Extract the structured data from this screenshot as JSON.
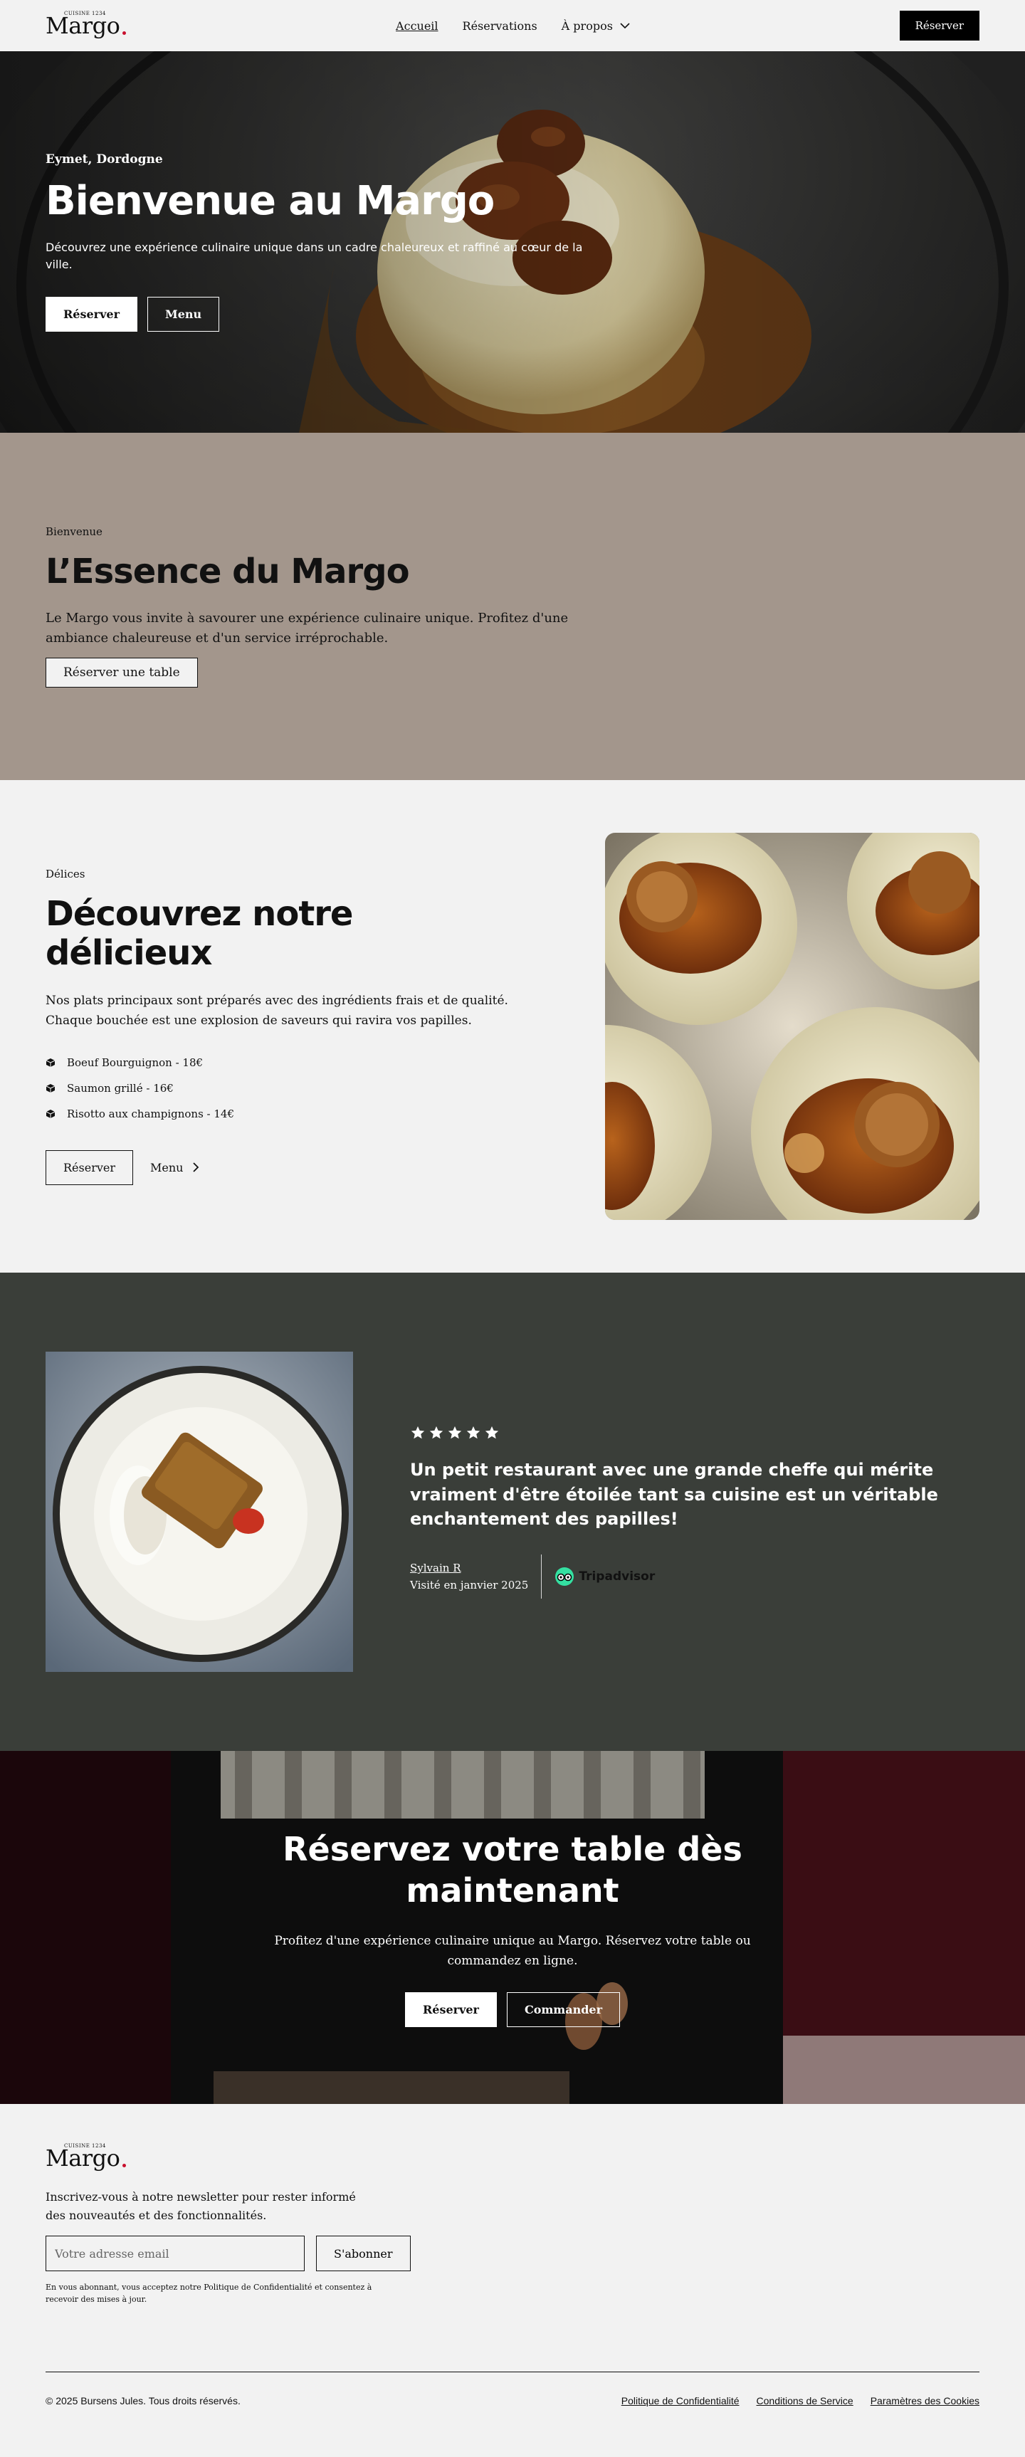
{
  "brand": {
    "name": "Margo",
    "tagline": "CUISINE 1234",
    "dot_color": "#c8102e"
  },
  "nav": {
    "links": [
      "Accueil",
      "Réservations",
      "À propos"
    ],
    "cta": "Réserver"
  },
  "hero": {
    "location": "Eymet, Dordogne",
    "title": "Bienvenue au Margo",
    "description": "Découvrez une expérience culinaire unique dans un cadre chaleureux et raffiné au cœur de la ville.",
    "btn_primary": "Réserver",
    "btn_secondary": "Menu"
  },
  "essence": {
    "eyebrow": "Bienvenue",
    "title": "L’Essence du Margo",
    "description": "Le Margo vous invite à savourer une expérience culinaire unique. Profitez d'une ambiance chaleureuse et d'un service irréprochable.",
    "button": "Réserver une table",
    "bg_color": "#a3968c"
  },
  "delices": {
    "eyebrow": "Délices",
    "title": "Découvrez notre délicieux",
    "description": "Nos plats principaux sont préparés avec des ingrédients frais et de qualité. Chaque bouchée est une explosion de saveurs qui ravira vos papilles.",
    "dishes": [
      "Boeuf Bourguignon - 18€",
      "Saumon grillé - 16€",
      "Risotto aux champignons - 14€"
    ],
    "btn_reserve": "Réserver",
    "btn_menu": "Menu"
  },
  "testimonial": {
    "rating": 5,
    "quote": "Un petit restaurant avec une grande cheffe qui mérite vraiment d'être étoilée tant sa cuisine est un véritable enchantement des papilles!",
    "author": "Sylvain R",
    "date": "Visité en janvier 2025",
    "source": "Tripadvisor",
    "bg_color": "#3a3e39"
  },
  "cta": {
    "title": "Réservez votre table dès maintenant",
    "description": "Profitez d'une expérience culinaire unique au Margo. Réservez votre table ou commandez en ligne.",
    "btn_reserve": "Réserver",
    "btn_order": "Commander"
  },
  "footer": {
    "newsletter_text": "Inscrivez-vous à notre newsletter pour rester informé des nouveautés et des fonctionnalités.",
    "email_placeholder": "Votre adresse email",
    "subscribe": "S'abonner",
    "fine_print": "En vous abonnant, vous acceptez notre Politique de Confidentialité et consentez à recevoir des mises à jour.",
    "copyright": "© 2025 Bursens Jules. Tous droits réservés.",
    "links": [
      "Politique de Confidentialité",
      "Conditions de Service",
      "Paramètres des Cookies"
    ]
  }
}
